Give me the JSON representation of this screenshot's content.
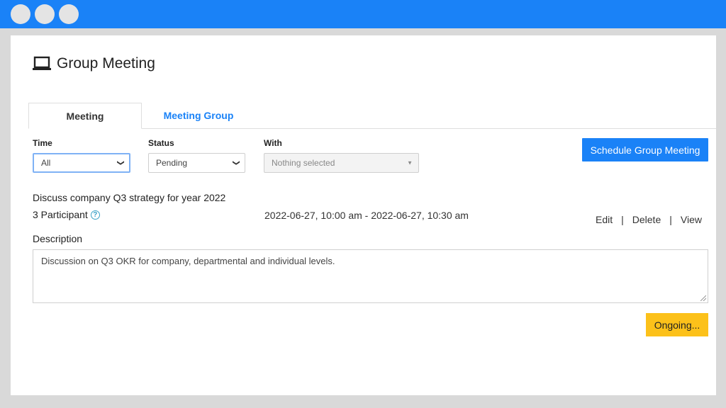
{
  "window": {
    "controls": [
      "close",
      "minimize",
      "maximize"
    ]
  },
  "header": {
    "icon": "laptop-icon",
    "title": "Group Meeting"
  },
  "tabs": [
    {
      "label": "Meeting",
      "active": true
    },
    {
      "label": "Meeting Group",
      "active": false
    }
  ],
  "filters": {
    "time": {
      "label": "Time",
      "value": "All"
    },
    "status": {
      "label": "Status",
      "value": "Pending"
    },
    "with": {
      "label": "With",
      "value": "Nothing selected"
    }
  },
  "schedule_button": "Schedule Group Meeting",
  "meeting": {
    "title": "Discuss company Q3 strategy for year 2022",
    "participants": "3 Participant",
    "time_range": "2022-06-27, 10:00 am - 2022-06-27, 10:30 am",
    "actions": {
      "edit": "Edit",
      "delete": "Delete",
      "view": "View"
    },
    "description_label": "Description",
    "description": "Discussion on Q3 OKR for company, departmental and individual levels.",
    "status_button": "Ongoing..."
  },
  "colors": {
    "titlebar": "#1a82f7",
    "primary": "#1a82f7",
    "warning": "#fcc11a"
  }
}
